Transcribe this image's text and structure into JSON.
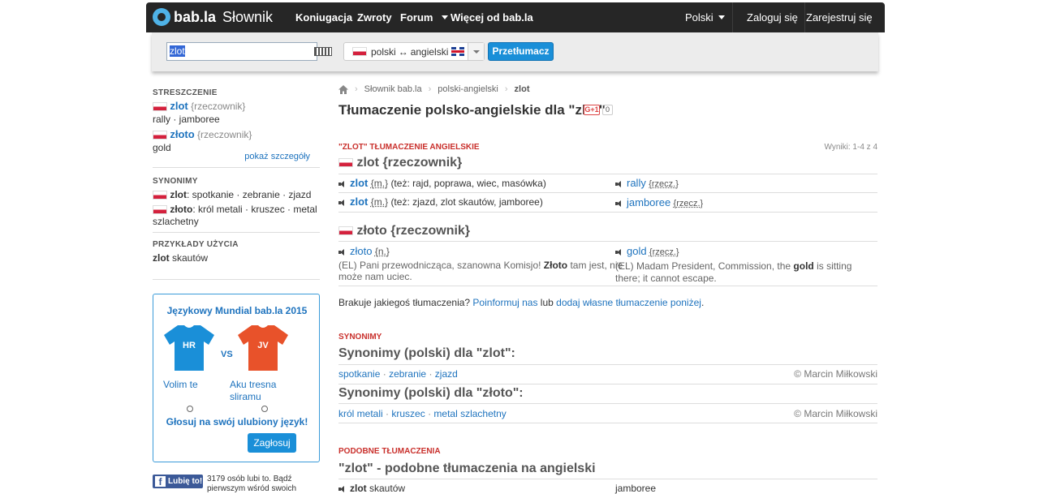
{
  "topbar": {
    "logo": "bab.la",
    "logo_sub": "Słownik",
    "nav": [
      "Koniugacja",
      "Zwroty",
      "Forum",
      "Więcej od bab.la"
    ],
    "language": "Polski",
    "login": "Zaloguj się",
    "register": "Zarejestruj się"
  },
  "search": {
    "value": "zlot",
    "lang_from": "polski",
    "arrow": "↔",
    "lang_to": "angielski",
    "button": "Przetłumacz"
  },
  "sidebar": {
    "summary_head": "STRESZCZENIE",
    "s1_word": "zlot",
    "s1_pos": "{rzeczownik}",
    "s1_trans": "rally · jamboree",
    "s2_word": "złoto",
    "s2_pos": "{rzeczownik}",
    "s2_trans": "gold",
    "details_link": "pokaż szczegóły",
    "syn_head": "SYNONIMY",
    "syn1_word": "zlot",
    "syn1_list": ": spotkanie · zebranie · zjazd",
    "syn2_word": "złoto",
    "syn2_list": ": król metali · kruszec · metal",
    "syn2_list2": "szlachetny",
    "examples_head": "PRZYKŁADY UŻYCIA",
    "ex_word": "zlot",
    "ex_rest": " skautów"
  },
  "promo": {
    "title": "Językowy Mundial bab.la 2015",
    "shirt1": "HR",
    "shirt2": "JV",
    "vs": "VS",
    "opt1": "Volim te",
    "opt2_line1": "Aku tresna",
    "opt2_line2": "sliramu",
    "cta": "Głosuj na swój ulubiony język!",
    "button": "Zagłosuj",
    "colors": {
      "shirt1": "#1a8fd8",
      "shirt2": "#e8522a"
    }
  },
  "facebook": {
    "button": "Lubię to!",
    "text1": "3179 osób lubi to. Bądź",
    "text2": "pierwszym wśród swoich"
  },
  "breadcrumb": {
    "items": [
      "Słownik bab.la",
      "polski-angielski",
      "zlot"
    ]
  },
  "main": {
    "title": "Tłumaczenie polsko-angielskie dla \"zlot\"",
    "gplus": "G+1",
    "gcount": "0",
    "section1_head": "\"ZLOT\" TŁUMACZENIE ANGIELSKIE",
    "results": "Wyniki: 1-4 z 4",
    "entry1": "zlot {rzeczownik}",
    "row1_word": "zlot",
    "row1_tag": "{m.}",
    "row1_also": "(też: rajd, poprawa, wiec, masówka)",
    "row1_trans": "rally",
    "row1_ttag": "{rzecz.}",
    "row2_word": "zlot",
    "row2_tag": "{m.}",
    "row2_also": "(też: zjazd, zlot skautów, jamboree)",
    "row2_trans": "jamboree",
    "row2_ttag": "{rzecz.}",
    "entry2": "złoto {rzeczownik}",
    "row3_word": "złoto",
    "row3_tag": "{n.}",
    "row3_trans": "gold",
    "row3_ttag": "{rzecz.}",
    "ex_pl_1a": "(EL) Pani przewodnicząca, szanowna Komisjo! ",
    "ex_pl_1b": "Złoto",
    "ex_pl_1c": " tam jest, nie",
    "ex_pl_2": "może nam uciec.",
    "ex_en_1a": "(EL) Madam President, Commission, the ",
    "ex_en_1b": "gold",
    "ex_en_1c": " is sitting",
    "ex_en_2": "there; it cannot escape.",
    "missing_a": "Brakuje jakiegoś tłumaczenia? ",
    "missing_link1": "Poinformuj nas",
    "missing_b": " lub ",
    "missing_link2": "dodaj własne tłumaczenie poniżej",
    "missing_c": ".",
    "syn_head": "SYNONIMY",
    "syn_title1": "Synonimy (polski) dla \"zlot\":",
    "syn_list1": [
      "spotkanie",
      "zebranie",
      "zjazd"
    ],
    "syn_credit1": "© Marcin Miłkowski",
    "syn_title2": "Synonimy (polski) dla \"złoto\":",
    "syn_list2": [
      "król metali",
      "kruszec",
      "metal szlachetny"
    ],
    "syn_credit2": "© Marcin Miłkowski",
    "similar_head": "PODOBNE TŁUMACZENIA",
    "similar_title": "\"zlot\" - podobne tłumaczenia na angielski",
    "sim_word": "zlot",
    "sim_rest": " skautów",
    "sim_trans": "jamboree"
  }
}
